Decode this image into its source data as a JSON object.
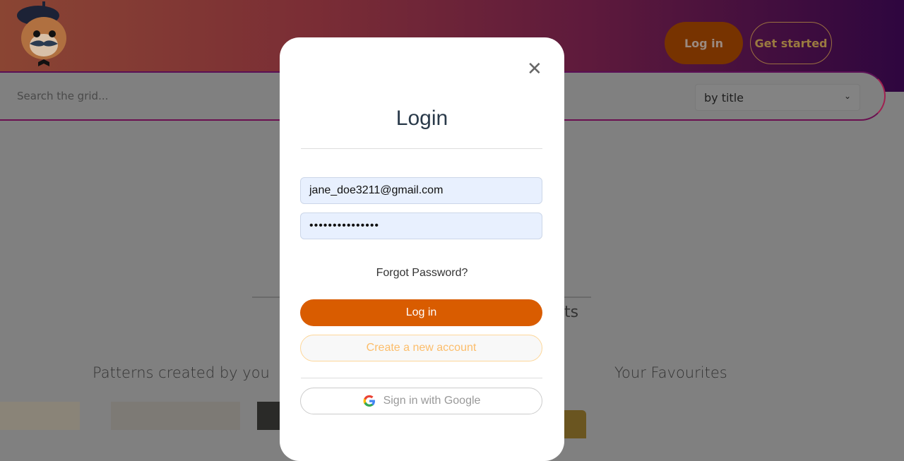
{
  "header": {
    "logo": "pixel cat with beret and moustache",
    "login_label": "Log in",
    "get_started_label": "Get started"
  },
  "search": {
    "placeholder": "Search the grid...",
    "sort_value": "by title"
  },
  "background": {
    "partial_heading": "ts",
    "section_left": "Patterns created by you",
    "section_right": "Your Favourites"
  },
  "modal": {
    "title": "Login",
    "email": "jane_doe3211@gmail.com",
    "password": "•••••••••••••••",
    "forgot": "Forgot Password?",
    "login_label": "Log in",
    "create_label": "Create a new account",
    "google_label": "Sign in with Google"
  },
  "colors": {
    "accent": "#d95c00",
    "create_border": "#fdd79a",
    "field_bg": "#e8f0fe"
  }
}
